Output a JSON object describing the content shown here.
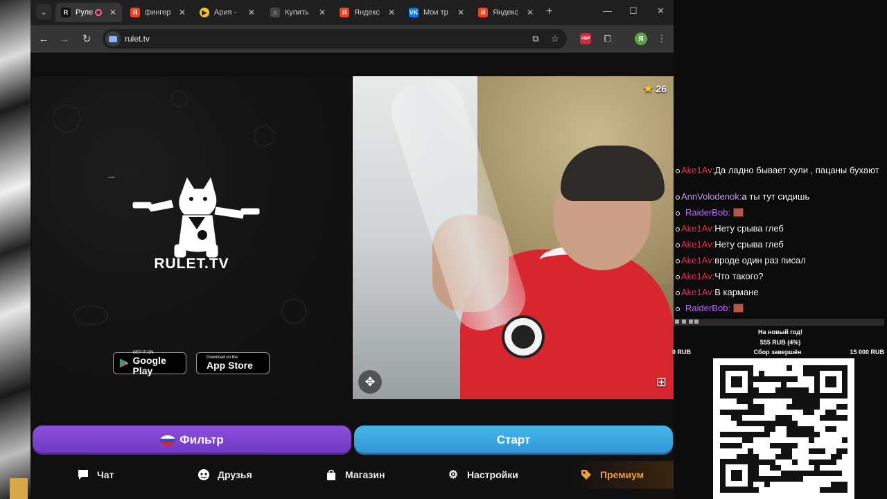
{
  "browser": {
    "tabs": [
      {
        "title": "Руле",
        "favicon": "rulet-tv-favicon",
        "active": true,
        "recording": true
      },
      {
        "title": "фингер",
        "favicon": "yandex-favicon"
      },
      {
        "title": "Ария -",
        "favicon": "play-favicon"
      },
      {
        "title": "Купить",
        "favicon": "shop-favicon"
      },
      {
        "title": "Яндекс",
        "favicon": "yandex-favicon"
      },
      {
        "title": "Мои тр",
        "favicon": "vk-favicon"
      },
      {
        "title": "Яндекс",
        "favicon": "yandex-favicon"
      }
    ],
    "url": "rulet.tv",
    "profile_letter": "Я",
    "abp_label": "ABP"
  },
  "page": {
    "brand": "RULET.TV",
    "google_play": {
      "small": "GET IT ON",
      "big": "Google Play"
    },
    "app_store": {
      "small": "Download on the",
      "big": "App Store"
    },
    "star_count": "26",
    "filter_button": "Фильтр",
    "start_button": "Старт",
    "nav": [
      {
        "label": "Чат",
        "icon": "chat-icon"
      },
      {
        "label": "Друзья",
        "icon": "friends-icon"
      },
      {
        "label": "Магазин",
        "icon": "shop-bag-icon"
      },
      {
        "label": "Настройки",
        "icon": "gear-icon"
      },
      {
        "label": "Премиум",
        "icon": "tag-icon"
      }
    ]
  },
  "chat": [
    {
      "user": "Ake1Av",
      "text": "Да ладно бывает хули , пацаны бухают"
    },
    {
      "user": "AnnVolodenok",
      "text": "а ты тут сидишь"
    },
    {
      "user": "RaiderBob",
      "text": "",
      "emote": true
    },
    {
      "user": "Ake1Av",
      "text": "Нету срыва глеб"
    },
    {
      "user": "Ake1Av",
      "text": "Нету срыва глеб"
    },
    {
      "user": "Ake1Av",
      "text": "вроде один раз писал"
    },
    {
      "user": "Ake1Av",
      "text": "Что такого?"
    },
    {
      "user": "Ake1Av",
      "text": "В кармане"
    },
    {
      "user": "RaiderBob",
      "text": "",
      "emote": true
    }
  ],
  "fundraiser": {
    "title": "На новый год!",
    "amount": "555 RUB (4%)",
    "progress_percent": 4,
    "min": "0 RUB",
    "status": "Сбор завершён",
    "max": "15 000 RUB"
  },
  "colors": {
    "filter_button": "#7a3fd0",
    "start_button": "#3aa6e0",
    "user_ake": "#ff2e5f",
    "user_ann": "#c7a3ff",
    "user_raider": "#c07bff"
  }
}
